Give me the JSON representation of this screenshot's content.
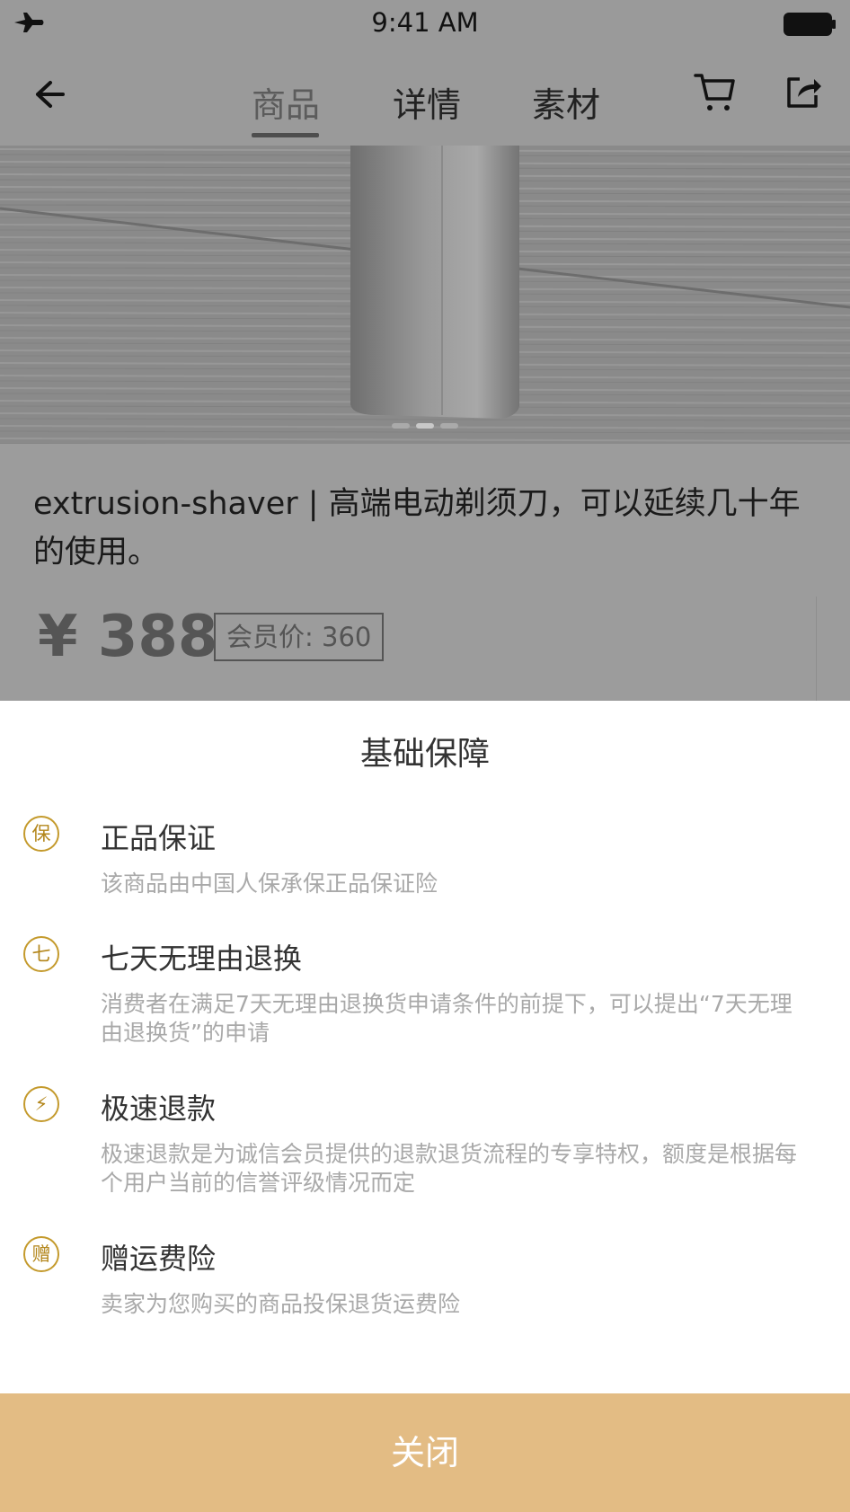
{
  "status_bar": {
    "time": "9:41 AM"
  },
  "nav": {
    "tabs": [
      {
        "label": "商品",
        "active": true
      },
      {
        "label": "详情",
        "active": false
      },
      {
        "label": "素材",
        "active": false
      }
    ]
  },
  "product": {
    "title": "extrusion-shaver | 高端电动剃须刀，可以延续几十年的使用。",
    "price": "¥ 388",
    "member_price": "会员价: 360",
    "image_pages": 3,
    "current_image": 2
  },
  "sheet": {
    "heading": "基础保障",
    "items": [
      {
        "badge": "保",
        "title": "正品保证",
        "desc": "该商品由中国人保承保正品保证险"
      },
      {
        "badge": "七",
        "title": "七天无理由退换",
        "desc": "消费者在满足7天无理由退换货申请条件的前提下，可以提出“7天无理由退换货”的申请"
      },
      {
        "badge": "⚡",
        "title": "极速退款",
        "desc": "极速退款是为诚信会员提供的退款退货流程的专享特权，额度是根据每个用户当前的信誉评级情况而定"
      },
      {
        "badge": "赠",
        "title": "赠运费险",
        "desc": "卖家为您购买的商品投保退货运费险"
      }
    ],
    "close_label": "关闭"
  },
  "colors": {
    "accent": "#e3bc84",
    "badge": "#c49a2c",
    "overlay_gray": "#9a9a9a"
  }
}
